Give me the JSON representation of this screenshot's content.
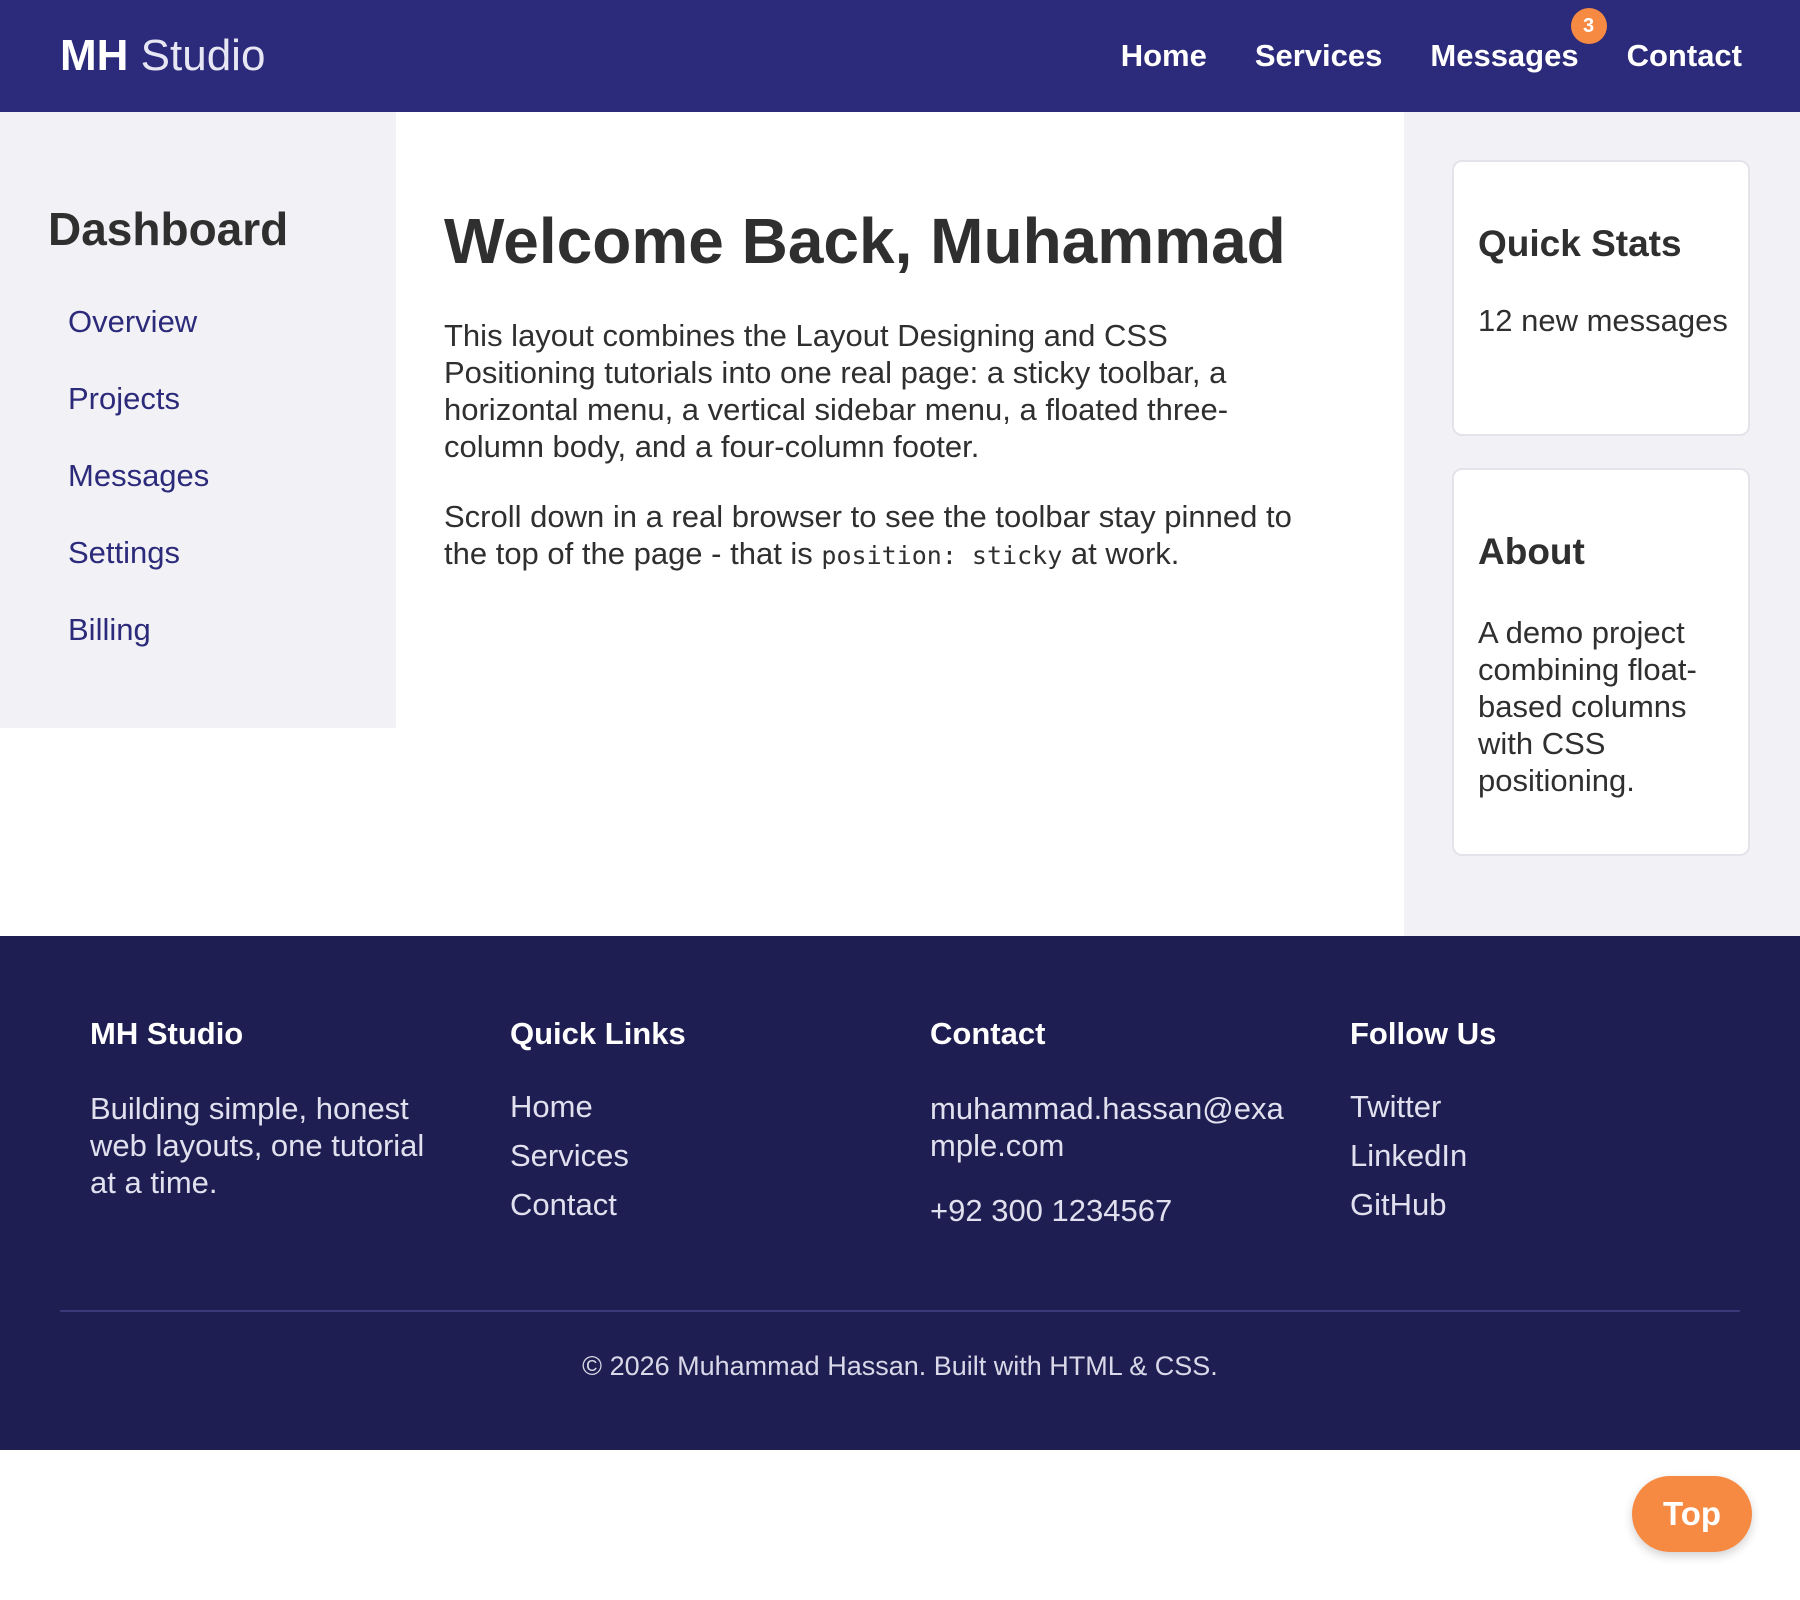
{
  "header": {
    "brand_bold": "MH",
    "brand_light": "Studio",
    "nav": [
      {
        "label": "Home"
      },
      {
        "label": "Services"
      },
      {
        "label": "Messages",
        "badge": "3"
      },
      {
        "label": "Contact"
      }
    ]
  },
  "sidebar": {
    "title": "Dashboard",
    "items": [
      {
        "label": "Overview"
      },
      {
        "label": "Projects"
      },
      {
        "label": "Messages"
      },
      {
        "label": "Settings"
      },
      {
        "label": "Billing"
      }
    ]
  },
  "main": {
    "title": "Welcome Back, Muhammad",
    "para1": "This layout combines the Layout Designing and CSS Positioning tutorials into one real page: a sticky toolbar, a horizontal menu, a vertical sidebar menu, a floated three-column body, and a four-column footer.",
    "para2_before": "Scroll down in a real browser to see the toolbar stay pinned to the top of the page - that is ",
    "para2_code": "position: sticky",
    "para2_after": " at work."
  },
  "cards": {
    "stats_title": "Quick Stats",
    "stats_text": "12 new messages",
    "about_title": "About",
    "about_text": "A demo project combining float-based columns with CSS positioning."
  },
  "footer": {
    "col1": {
      "title": "MH Studio",
      "text": "Building simple, honest web layouts, one tutorial at a time."
    },
    "col2": {
      "title": "Quick Links",
      "links": [
        "Home",
        "Services",
        "Contact"
      ]
    },
    "col3": {
      "title": "Contact",
      "email": "muhammad.hassan@example.com",
      "phone": "+92 300 1234567"
    },
    "col4": {
      "title": "Follow Us",
      "links": [
        "Twitter",
        "LinkedIn",
        "GitHub"
      ]
    },
    "copyright": "© 2026 Muhammad Hassan. Built with HTML & CSS."
  },
  "top_button": "Top",
  "colors": {
    "header_bg": "#2c2a7a",
    "footer_bg": "#1f1e52",
    "accent": "#f68a43",
    "link": "#2c2a7a",
    "panel_bg": "#f2f2f6"
  }
}
